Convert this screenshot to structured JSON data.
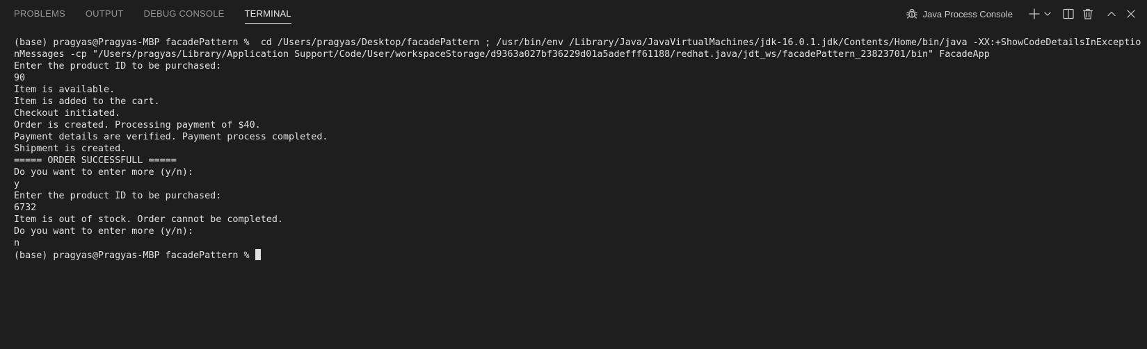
{
  "tabs": [
    {
      "label": "PROBLEMS"
    },
    {
      "label": "OUTPUT"
    },
    {
      "label": "DEBUG CONSOLE"
    },
    {
      "label": "TERMINAL"
    }
  ],
  "active_tab": "TERMINAL",
  "console": {
    "name": "Java Process Console",
    "icon": "bug-icon"
  },
  "toolbar_icons": [
    "add-terminal-icon",
    "chevron-down-icon",
    "split-terminal-icon",
    "trash-icon",
    "maximize-panel-icon",
    "close-icon"
  ],
  "terminal": {
    "lines": [
      "(base) pragyas@Pragyas-MBP facadePattern %  cd /Users/pragyas/Desktop/facadePattern ; /usr/bin/env /Library/Java/JavaVirtualMachines/jdk-16.0.1.jdk/Contents/Home/bin/java -XX:+ShowCodeDetailsInExceptio",
      "nMessages -cp \"/Users/pragyas/Library/Application Support/Code/User/workspaceStorage/d9363a027bf36229d01a5adefff61188/redhat.java/jdt_ws/facadePattern_23823701/bin\" FacadeApp",
      "Enter the product ID to be purchased:",
      "90",
      "Item is available.",
      "Item is added to the cart.",
      "Checkout initiated.",
      "Order is created. Processing payment of $40.",
      "Payment details are verified. Payment process completed.",
      "Shipment is created.",
      "===== ORDER SUCCESSFULL =====",
      "Do you want to enter more (y/n):",
      "y",
      "Enter the product ID to be purchased:",
      "6732",
      "Item is out of stock. Order cannot be completed.",
      "Do you want to enter more (y/n):",
      "n"
    ],
    "prompt": "(base) pragyas@Pragyas-MBP facadePattern % "
  },
  "colors": {
    "background": "#1e1e1e",
    "text": "#e0e0e0",
    "inactive_tab": "#969696",
    "active_tab": "#e7e7e7"
  }
}
